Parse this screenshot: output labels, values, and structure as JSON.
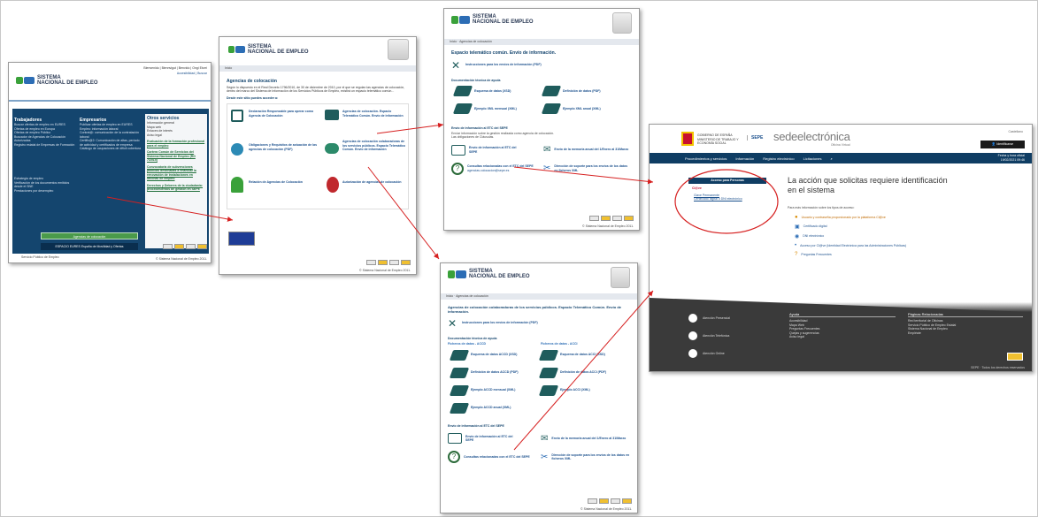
{
  "colors": {
    "brand_green": "#3aa13a",
    "brand_blue": "#2c6db5",
    "navy": "#0f3d63",
    "dark_panel": "#3a3a3a",
    "arrow": "#d62020",
    "sede_red": "#b31b1b"
  },
  "shot1": {
    "logo": "SISTEMA\nNACIONAL DE EMPLEO",
    "top_links": "Bienvenido | Biennvigut | Benvido | Ongi Etorri",
    "top_links2": "Accesibilidad | Buscar",
    "col1_title": "Trabajadores",
    "col1_items": [
      "Buscar ofertas de empleo en EURES",
      "Ofertas de empleo en Europa",
      "Ofertas de empleo Público",
      "Buscador de Agencias de Colocación Autorizadas",
      "Registro estatal de Empresas de Formación"
    ],
    "col2_title": "Empresarios",
    "col2_items": [
      "Publicar ofertas de empleo en EURES",
      "Empleo: información laboral",
      "Contrat@: comunicación de la contratación laboral",
      "Certific@2: Comunicación de altas, período de actividad y certificados de empresa",
      "Catálogo de ocupaciones de difícil cobertura"
    ],
    "col3_title": "Otros servicios",
    "col3_items": [
      "Información general",
      "Mapa web",
      "Enlaces de interés",
      "Aviso legal"
    ],
    "col3_links": [
      "Evaluación de la formación profesional para el empleo",
      "Cartera Común de Servicios del Sistema Nacional de Empleo (RD 7/2015)",
      "Convocatoria de subvenciones públicas destinadas a financiar la renovación de instalaciones en oficinas de empleo",
      "Derechos y Deberes de la ciudadanía: procedimientos de gestión en SEPE"
    ],
    "col1_more": [
      "Estrategia de empleo",
      "Verificación de los documentos emitidos desde el SNE",
      "Prestaciones por desempleo"
    ],
    "highlight": "Agencias de colocación",
    "bottom_bar": "ESPACIO EURES España de Movilidad y Ofertas",
    "sepe": "Servicio Público de Empleo",
    "copyright": "© Sistema Nacional de Empleo 2011."
  },
  "shot2": {
    "logo": "SISTEMA\nNACIONAL DE EMPLEO",
    "crumb": "Inicio",
    "title": "Agencias de colocación",
    "intro": "Según lo dispuesto en el Real Decreto 1796/2010, de 30 de diciembre de 2010, por el que se regulan las agencias de colocación, dentro del marco del Sistema de Información de los Servicios Públicos de Empleo, existirá un espacio telemático común...",
    "subtitle": "Desde este sitio puedes acceder a:",
    "items": [
      "Declaración Responsable para operar como Agencia de Colocación",
      "Agencias de colocación. Espacio Telemático Común. Envío de información",
      "Obligaciones y Requisitos de actuación de las agencias de colocación (PDF)",
      "Agencias de colocación colaboradoras de los servicios públicos. Espacio Telemático Común. Envío de información",
      "Relación de Agencias de Colocación",
      "Autorización de agencias de colocación"
    ],
    "copyright": "© Sistema Nacional de Empleo 2011."
  },
  "shot3": {
    "logo": "SISTEMA\nNACIONAL DE EMPLEO",
    "crumb": "Inicio · Agencias de colocación",
    "title": "Espacio telemático común. Envío de información.",
    "instr": "Instrucciones para los envíos de información (PDF)",
    "doc_title": "Documentación técnica de ayuda",
    "docs": [
      "Esquema de datos (XSD)",
      "Definición de datos (PDF)",
      "Ejemplo XML mensual (XML)",
      "Ejemplo XML anual (XML)"
    ],
    "send_title": "Envío de información al ETC del SEPE",
    "send_text": "Envíar información sobre la gestión realizada como agencia de colocación. Las obligaciones de Cláusulas.",
    "send_items": [
      "Envío de información al ETC del SEPE",
      "Envío de la memoria anual del 1/Enero al 31/Marzo"
    ],
    "contact_items": [
      "Consultas relacionadas con el ETC del SEPE",
      "Dirección de soporte para los envíos de los datos en ficheros XML"
    ],
    "mail": "agencias.colocacion@sepe.es",
    "copyright": "© Sistema Nacional de Empleo 2011."
  },
  "shot4": {
    "logo": "SISTEMA\nNACIONAL DE EMPLEO",
    "crumb": "Inicio · Agencias de colocación",
    "title": "Agencias de colocación colaboradoras de los servicios públicos. Espacio Telemático Común. Envío de información.",
    "instr": "Instrucciones para los envíos de información (PDF)",
    "doc_title": "Documentación técnica de ayuda",
    "sub_left": "Ficheros de datos - ACCD",
    "sub_right": "Ficheros de datos - ACCI",
    "docs": [
      "Esquema de datos ACCD (XSD)",
      "Esquema de datos ACCI (XSD)",
      "Definición de datos ACCD (PDF)",
      "Definición de datos ACCI (PDF)",
      "Ejemplo ACCD mensual (XML)",
      "Ejemplo ACCI (XML)",
      "Ejemplo ACCD anual (XML)"
    ],
    "send_title": "Envío de información al ETC del SEPE",
    "send_items": [
      "Envío de información al ETC del SEPE",
      "Envío de la memoria anual del 1/Enero al 31/Marzo"
    ],
    "contact_items": [
      "Consultas relacionadas con el ETC del SEPE",
      "Dirección de soporte para los envíos de los datos en ficheros XML"
    ],
    "copyright": "© Sistema Nacional de Empleo 2011."
  },
  "shot5": {
    "gov": "GOBIERNO DE ESPAÑA",
    "ministry": "MINISTERIO DE TRABAJO Y ECONOMÍA SOCIAL",
    "sepe": "SEPE",
    "sede": "sedeelectrónica",
    "sede_sub": "Oficina Virtual",
    "lang": "Castellano",
    "identify": "Identificarse",
    "nav": [
      "Procedimientos y servicios",
      "Información",
      "Registro electrónico",
      "Licitaciones"
    ],
    "date_label": "Fecha y hora oficial",
    "date_value": "19/02/2021 09:46",
    "access_title": "Acceso para Personas",
    "clave": "Cl@ve",
    "access_items": [
      "Clave Permanente",
      "Certificado digital o DNI electrónico"
    ],
    "heading": "La acción que solicitas requiere identificación en el sistema",
    "more": "Para más información sobre los tipos de acceso:",
    "links": [
      "Usuario y contraseña proporcionado por la plataforma Cl@ve",
      "Certificado digital",
      "DNI electrónico",
      "Acceso por Cl@ve (Identidad Electrónica para las Administraciones Públicas)",
      "Preguntas Frecuentes"
    ],
    "contact": [
      "Atención Presencial",
      "Atención Telefónica",
      "Atención Online"
    ],
    "help_title": "Ayuda",
    "help_items": [
      "Accesibilidad",
      "Mapa Web",
      "Preguntas Frecuentes",
      "Quejas y sugerencias",
      "Aviso legal"
    ],
    "related_title": "Páginas Relacionadas",
    "related_items": [
      "Red territorial de Oficinas",
      "Servicio Público de Empleo Estatal",
      "Sistema Nacional de Empleo",
      "Empléate"
    ],
    "footer": "SEPE · Todos los derechos reservados"
  }
}
